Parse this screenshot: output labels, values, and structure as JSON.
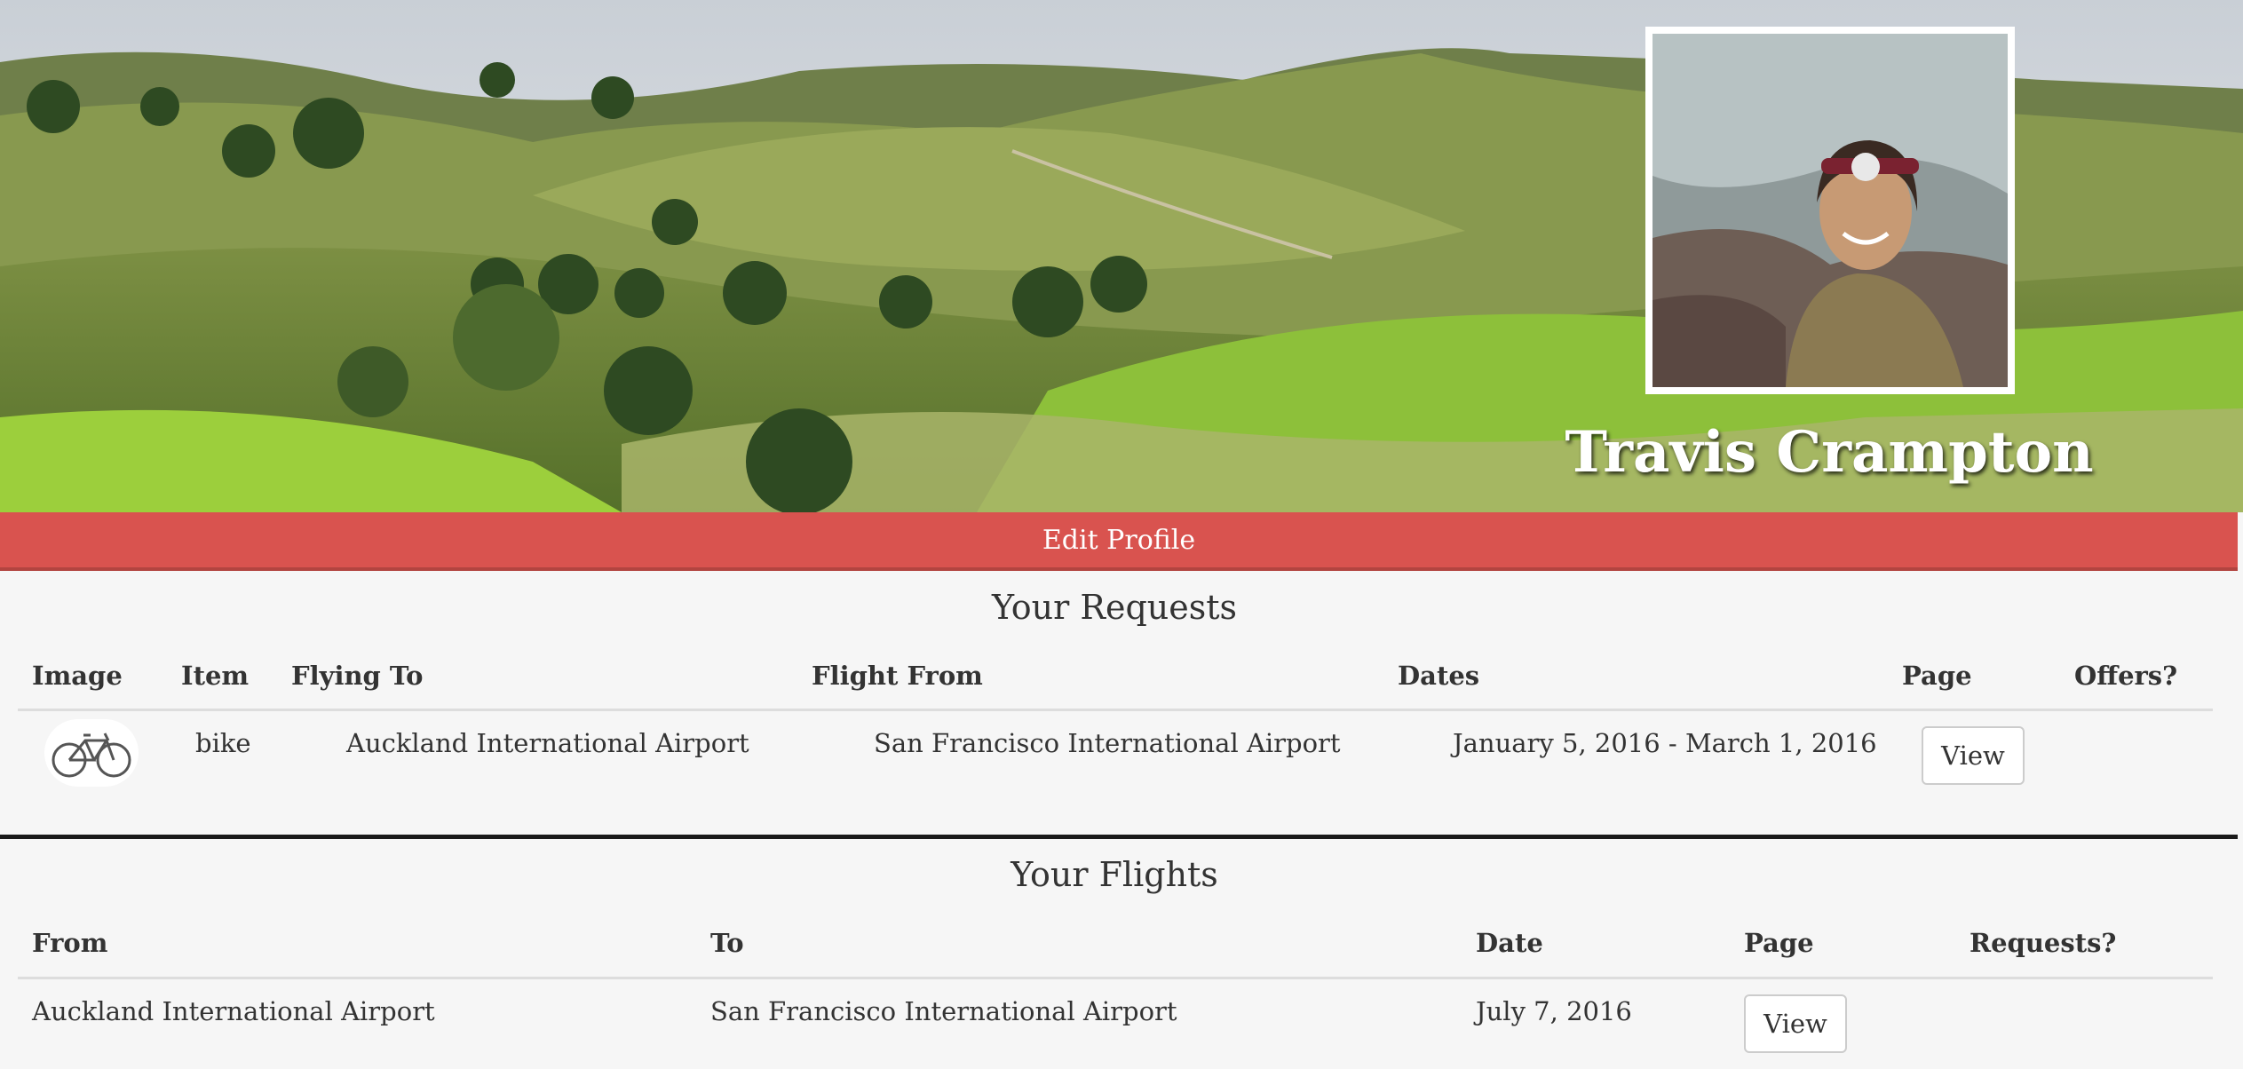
{
  "profile": {
    "name": "Travis Crampton",
    "edit_label": "Edit Profile"
  },
  "requests": {
    "title": "Your Requests",
    "columns": [
      "Image",
      "Item",
      "Flying To",
      "Flight From",
      "Dates",
      "Page",
      "Offers?"
    ],
    "rows": [
      {
        "image_icon": "bicycle-icon",
        "item": "bike",
        "flying_to": "Auckland International Airport",
        "flight_from": "San Francisco International Airport",
        "dates": "January 5, 2016 - March 1, 2016",
        "page_label": "View",
        "offers": ""
      }
    ]
  },
  "flights": {
    "title": "Your Flights",
    "columns": [
      "From",
      "To",
      "Date",
      "Page",
      "Requests?"
    ],
    "rows": [
      {
        "from": "Auckland International Airport",
        "to": "San Francisco International Airport",
        "date": "July 7, 2016",
        "page_label": "View",
        "requests": ""
      }
    ]
  },
  "colors": {
    "edit_button": "#d9534f",
    "background": "#f6f6f6"
  }
}
